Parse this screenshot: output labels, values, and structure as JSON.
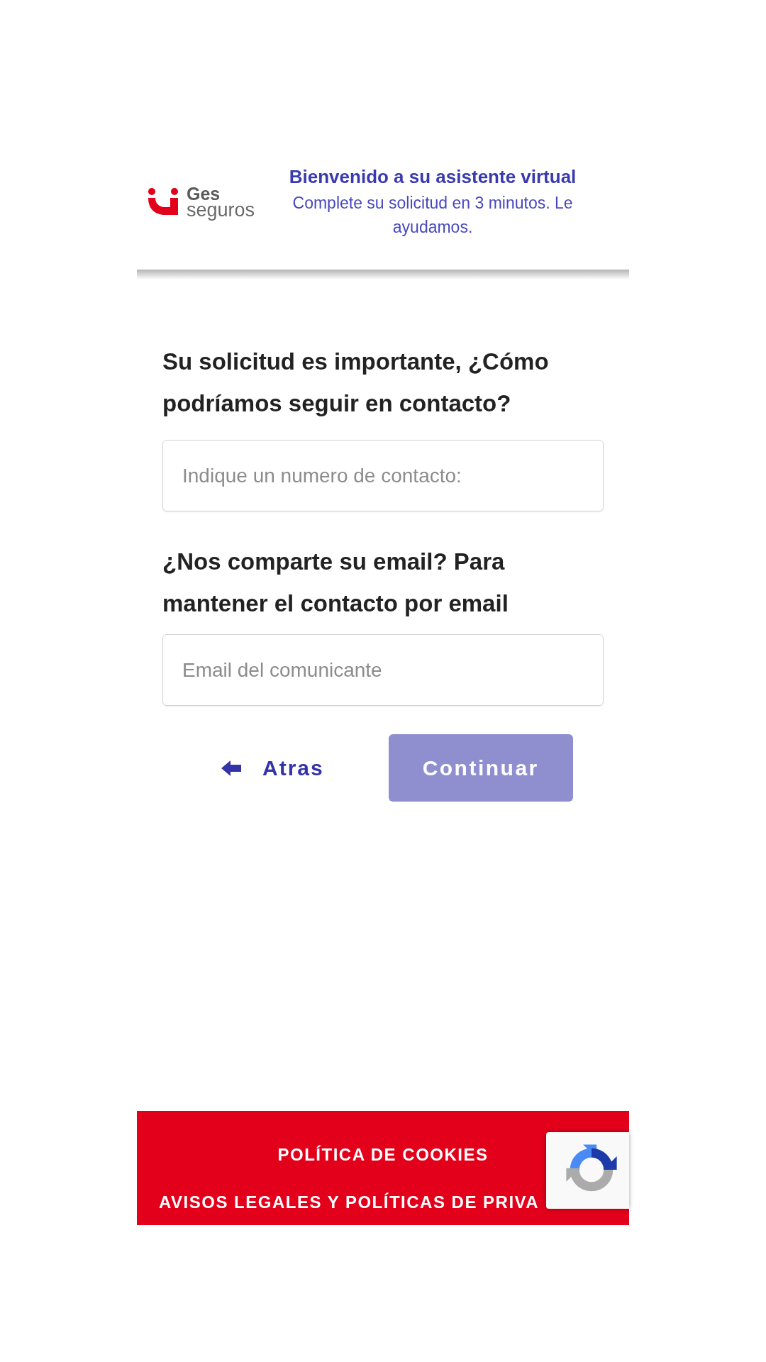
{
  "header": {
    "logo": {
      "line_1": "Ges",
      "line_2": "seguros"
    },
    "title": "Bienvenido a su asistente virtual",
    "subtitle": "Complete su solicitud en 3 minutos. Le ayudamos."
  },
  "form": {
    "fields": [
      {
        "question": "Su solicitud es importante, ¿Cómo podríamos seguir en contacto?",
        "placeholder": "Indique un numero de contacto:"
      },
      {
        "question": "¿Nos comparte su email? Para mantener el contacto por email",
        "placeholder": "Email del comunicante"
      }
    ],
    "buttons": [
      {
        "kind": "back",
        "label": "Atras"
      },
      {
        "kind": "primary",
        "label": "Continuar"
      }
    ]
  },
  "footer": {
    "links": [
      "POLÍTICA DE COOKIES",
      "AVISOS LEGALES Y POLÍTICAS DE PRIVA"
    ]
  }
}
